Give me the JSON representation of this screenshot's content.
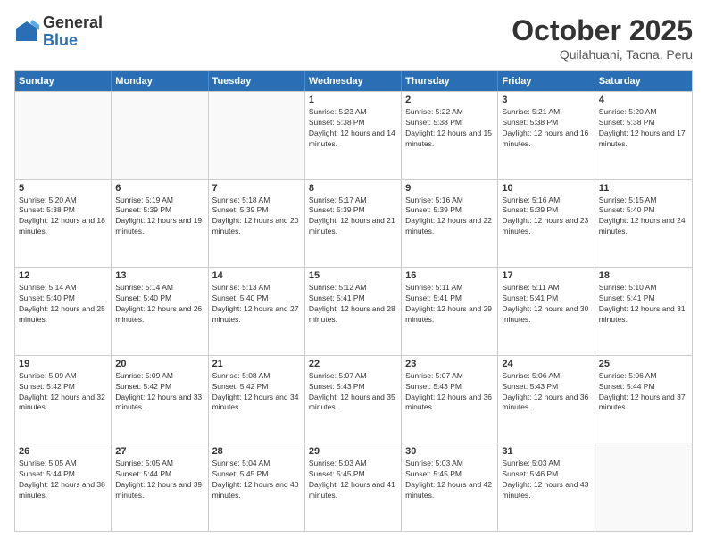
{
  "logo": {
    "general": "General",
    "blue": "Blue"
  },
  "header": {
    "month": "October 2025",
    "location": "Quilahuani, Tacna, Peru"
  },
  "weekdays": [
    "Sunday",
    "Monday",
    "Tuesday",
    "Wednesday",
    "Thursday",
    "Friday",
    "Saturday"
  ],
  "rows": [
    [
      {
        "day": "",
        "info": ""
      },
      {
        "day": "",
        "info": ""
      },
      {
        "day": "",
        "info": ""
      },
      {
        "day": "1",
        "info": "Sunrise: 5:23 AM\nSunset: 5:38 PM\nDaylight: 12 hours and 14 minutes."
      },
      {
        "day": "2",
        "info": "Sunrise: 5:22 AM\nSunset: 5:38 PM\nDaylight: 12 hours and 15 minutes."
      },
      {
        "day": "3",
        "info": "Sunrise: 5:21 AM\nSunset: 5:38 PM\nDaylight: 12 hours and 16 minutes."
      },
      {
        "day": "4",
        "info": "Sunrise: 5:20 AM\nSunset: 5:38 PM\nDaylight: 12 hours and 17 minutes."
      }
    ],
    [
      {
        "day": "5",
        "info": "Sunrise: 5:20 AM\nSunset: 5:38 PM\nDaylight: 12 hours and 18 minutes."
      },
      {
        "day": "6",
        "info": "Sunrise: 5:19 AM\nSunset: 5:39 PM\nDaylight: 12 hours and 19 minutes."
      },
      {
        "day": "7",
        "info": "Sunrise: 5:18 AM\nSunset: 5:39 PM\nDaylight: 12 hours and 20 minutes."
      },
      {
        "day": "8",
        "info": "Sunrise: 5:17 AM\nSunset: 5:39 PM\nDaylight: 12 hours and 21 minutes."
      },
      {
        "day": "9",
        "info": "Sunrise: 5:16 AM\nSunset: 5:39 PM\nDaylight: 12 hours and 22 minutes."
      },
      {
        "day": "10",
        "info": "Sunrise: 5:16 AM\nSunset: 5:39 PM\nDaylight: 12 hours and 23 minutes."
      },
      {
        "day": "11",
        "info": "Sunrise: 5:15 AM\nSunset: 5:40 PM\nDaylight: 12 hours and 24 minutes."
      }
    ],
    [
      {
        "day": "12",
        "info": "Sunrise: 5:14 AM\nSunset: 5:40 PM\nDaylight: 12 hours and 25 minutes."
      },
      {
        "day": "13",
        "info": "Sunrise: 5:14 AM\nSunset: 5:40 PM\nDaylight: 12 hours and 26 minutes."
      },
      {
        "day": "14",
        "info": "Sunrise: 5:13 AM\nSunset: 5:40 PM\nDaylight: 12 hours and 27 minutes."
      },
      {
        "day": "15",
        "info": "Sunrise: 5:12 AM\nSunset: 5:41 PM\nDaylight: 12 hours and 28 minutes."
      },
      {
        "day": "16",
        "info": "Sunrise: 5:11 AM\nSunset: 5:41 PM\nDaylight: 12 hours and 29 minutes."
      },
      {
        "day": "17",
        "info": "Sunrise: 5:11 AM\nSunset: 5:41 PM\nDaylight: 12 hours and 30 minutes."
      },
      {
        "day": "18",
        "info": "Sunrise: 5:10 AM\nSunset: 5:41 PM\nDaylight: 12 hours and 31 minutes."
      }
    ],
    [
      {
        "day": "19",
        "info": "Sunrise: 5:09 AM\nSunset: 5:42 PM\nDaylight: 12 hours and 32 minutes."
      },
      {
        "day": "20",
        "info": "Sunrise: 5:09 AM\nSunset: 5:42 PM\nDaylight: 12 hours and 33 minutes."
      },
      {
        "day": "21",
        "info": "Sunrise: 5:08 AM\nSunset: 5:42 PM\nDaylight: 12 hours and 34 minutes."
      },
      {
        "day": "22",
        "info": "Sunrise: 5:07 AM\nSunset: 5:43 PM\nDaylight: 12 hours and 35 minutes."
      },
      {
        "day": "23",
        "info": "Sunrise: 5:07 AM\nSunset: 5:43 PM\nDaylight: 12 hours and 36 minutes."
      },
      {
        "day": "24",
        "info": "Sunrise: 5:06 AM\nSunset: 5:43 PM\nDaylight: 12 hours and 36 minutes."
      },
      {
        "day": "25",
        "info": "Sunrise: 5:06 AM\nSunset: 5:44 PM\nDaylight: 12 hours and 37 minutes."
      }
    ],
    [
      {
        "day": "26",
        "info": "Sunrise: 5:05 AM\nSunset: 5:44 PM\nDaylight: 12 hours and 38 minutes."
      },
      {
        "day": "27",
        "info": "Sunrise: 5:05 AM\nSunset: 5:44 PM\nDaylight: 12 hours and 39 minutes."
      },
      {
        "day": "28",
        "info": "Sunrise: 5:04 AM\nSunset: 5:45 PM\nDaylight: 12 hours and 40 minutes."
      },
      {
        "day": "29",
        "info": "Sunrise: 5:03 AM\nSunset: 5:45 PM\nDaylight: 12 hours and 41 minutes."
      },
      {
        "day": "30",
        "info": "Sunrise: 5:03 AM\nSunset: 5:45 PM\nDaylight: 12 hours and 42 minutes."
      },
      {
        "day": "31",
        "info": "Sunrise: 5:03 AM\nSunset: 5:46 PM\nDaylight: 12 hours and 43 minutes."
      },
      {
        "day": "",
        "info": ""
      }
    ]
  ]
}
